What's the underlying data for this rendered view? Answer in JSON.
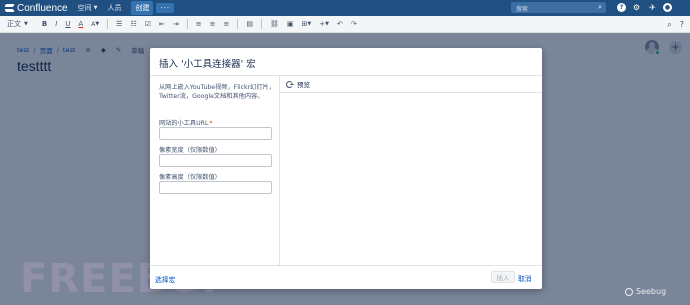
{
  "topnav": {
    "logo": "Confluence",
    "spaces": "空间",
    "people": "人员",
    "create": "创建",
    "more": "···",
    "search_placeholder": "搜索",
    "icons": [
      "search-icon",
      "help-icon",
      "notifications-icon",
      "feedback-icon",
      "user-icon"
    ]
  },
  "toolbar": {
    "style_select": "正文",
    "bold": "B",
    "italic": "I",
    "underline": "U",
    "color": "A",
    "more_format": "A",
    "icons": [
      "bullet-list-icon",
      "numbered-list-icon",
      "task-list-icon",
      "outdent-icon",
      "indent-icon",
      "align-left-icon",
      "align-center-icon",
      "align-right-icon",
      "page-layout-icon",
      "link-icon",
      "image-icon",
      "table-icon",
      "insert-more-icon",
      "undo-icon",
      "redo-icon",
      "find-icon",
      "help-icon"
    ]
  },
  "page": {
    "breadcrumb": [
      "test",
      "页面",
      "test"
    ],
    "restrictions": "草稿",
    "title": "testttt"
  },
  "dialog": {
    "title": "插入 '小工具连接器' 宏",
    "intro": "从网上嵌入YouTube视频，Flickr幻灯片，Twitter流，Google文档和其他内容。",
    "url_label": "网站的小工具URL",
    "url_required": "*",
    "url_value": "",
    "width_label": "像素宽度（仅限数值）",
    "width_value": "",
    "height_label": "像素高度（仅限数值）",
    "height_value": "",
    "preview_label": "预览",
    "select_macro": "选择宏",
    "insert": "插入",
    "cancel": "取消"
  },
  "watermarks": {
    "left": "FREEBUF",
    "right": "Seebug"
  }
}
